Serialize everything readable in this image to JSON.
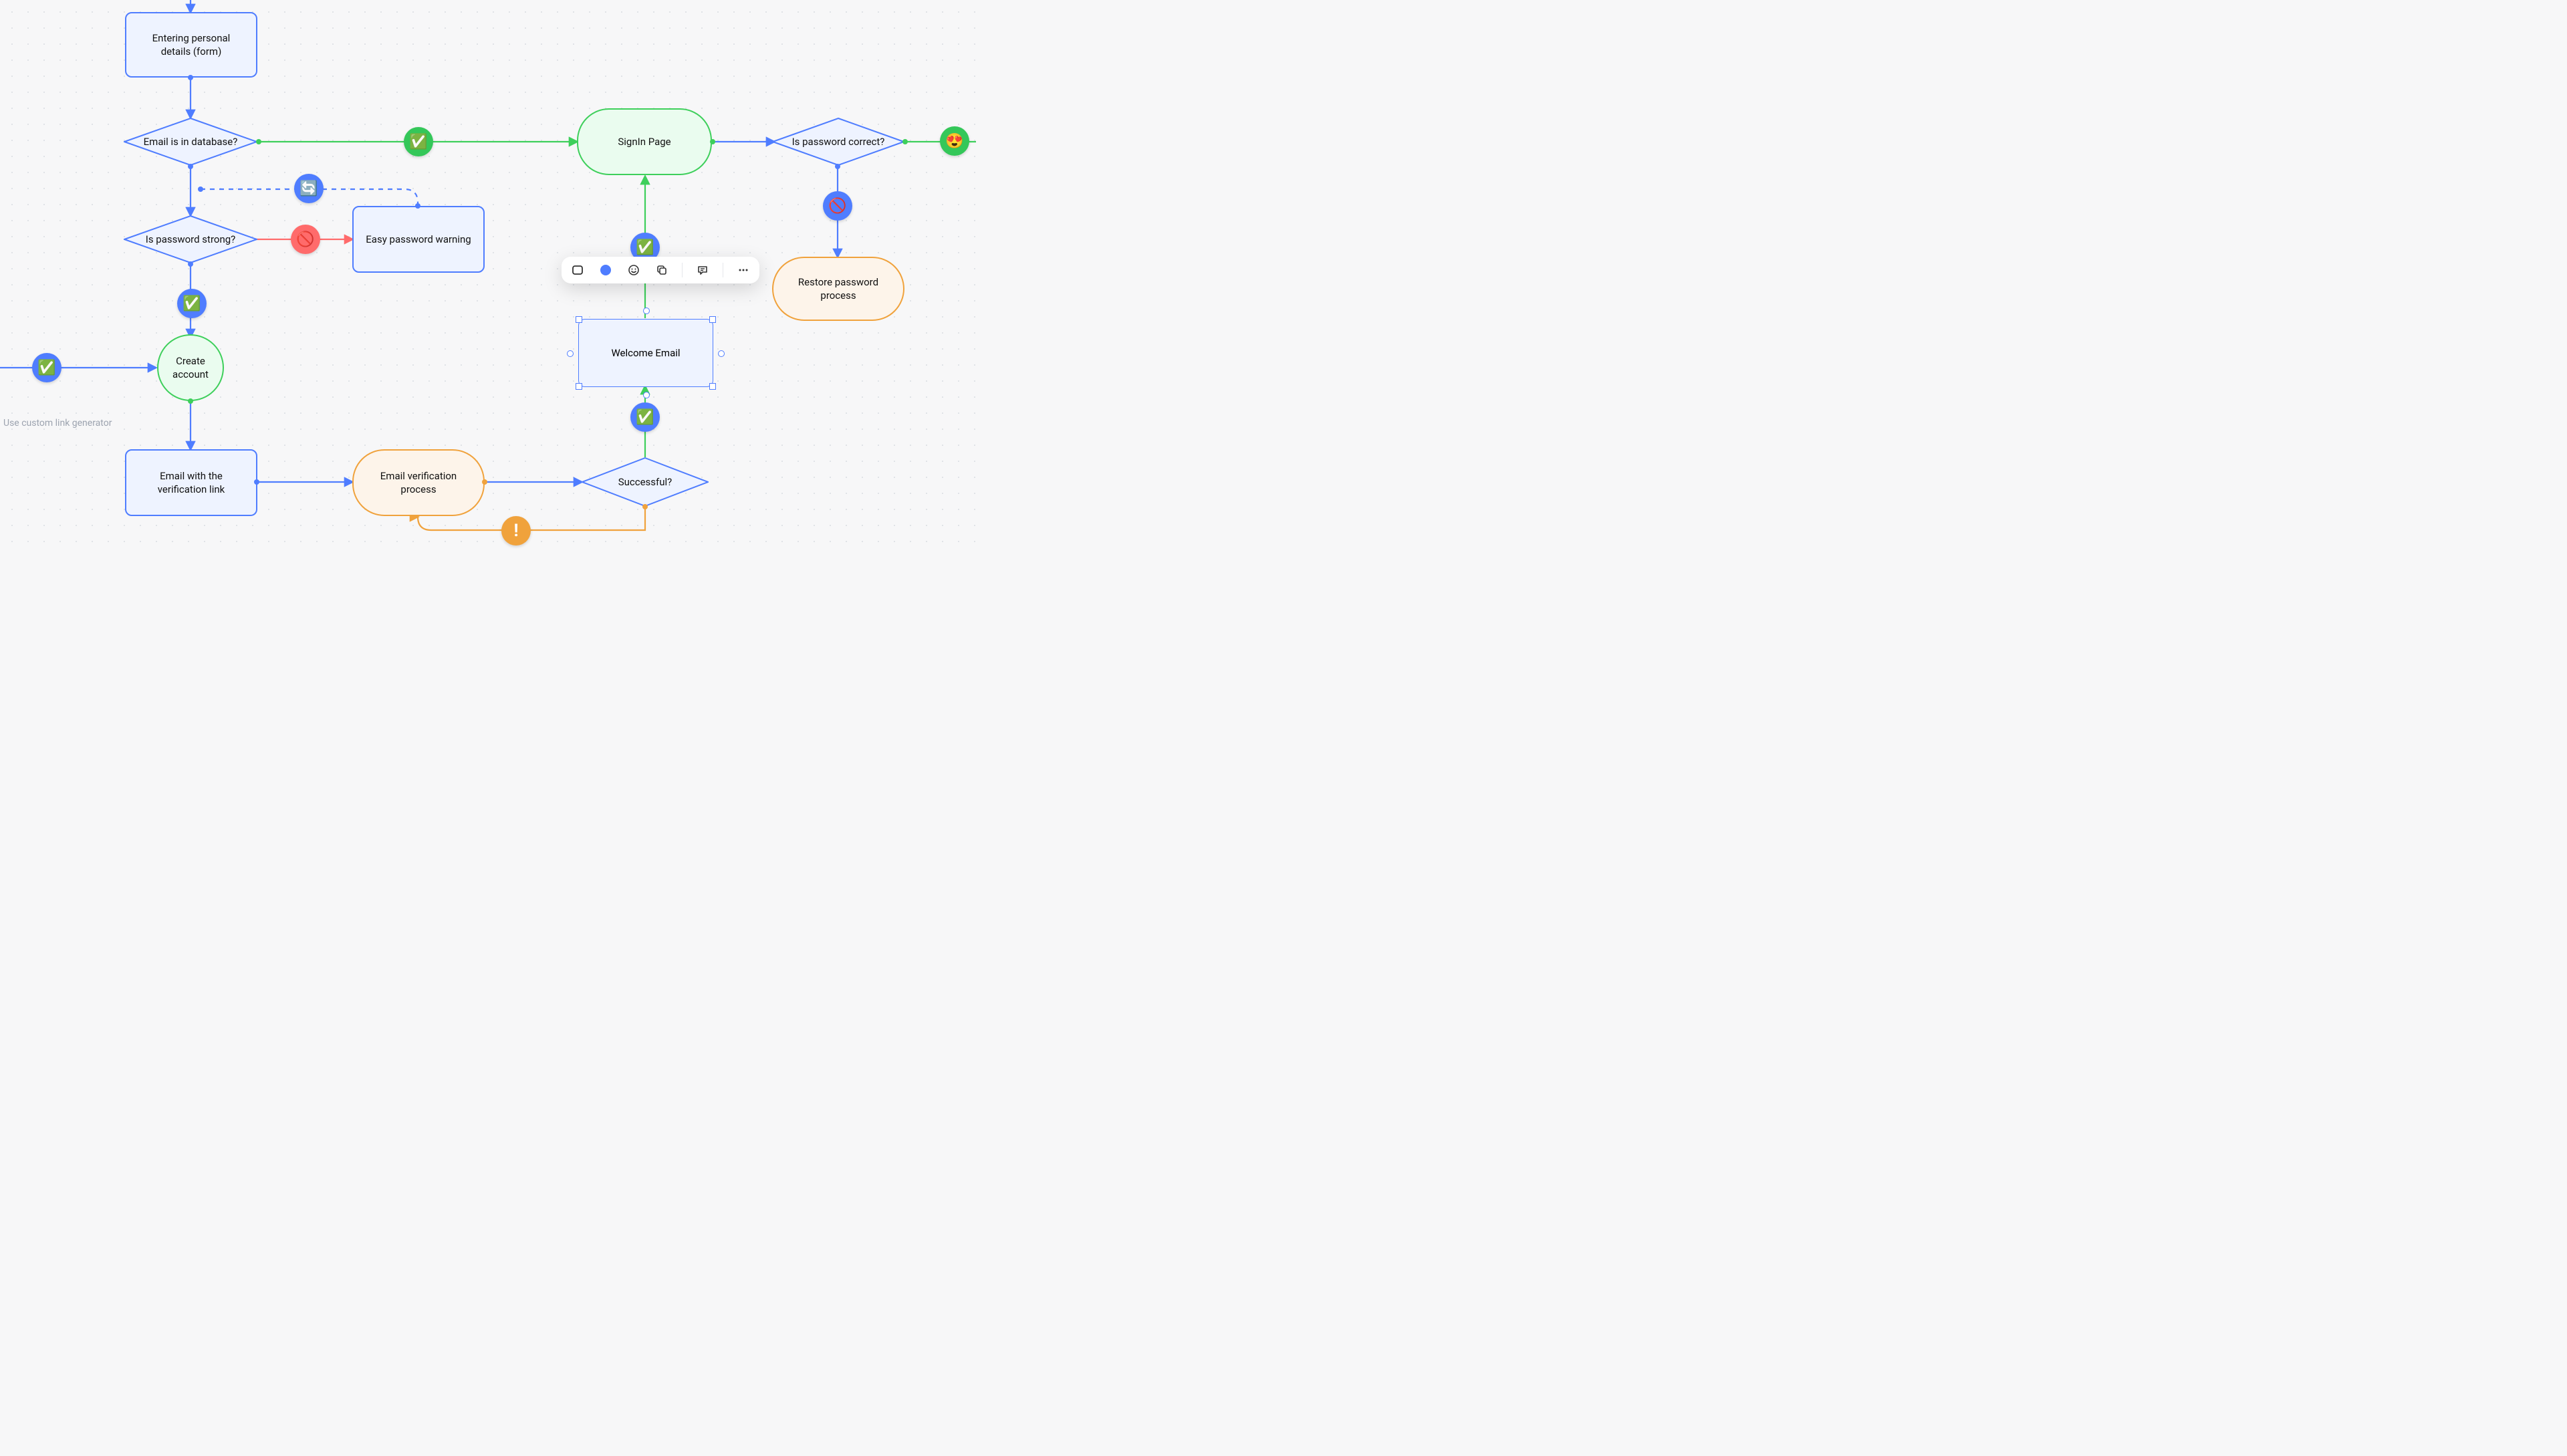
{
  "nodes": {
    "personal_details": "Entering personal\ndetails (form)",
    "email_db": "Email is in database?",
    "pw_strong": "Is password strong?",
    "pw_warning": "Easy password warning",
    "create_account": "Create\naccount",
    "email_link": "Email with the\nverification link",
    "email_verify": "Email verification\nprocess",
    "successful": "Successful?",
    "welcome": "Welcome Email",
    "signin": "SignIn Page",
    "pw_correct": "Is password correct?",
    "restore_pw": "Restore password\nprocess"
  },
  "note": "Use custom link generator",
  "badges": {
    "check": "✅",
    "check2": "✅",
    "check3": "✅",
    "check4": "✅",
    "check5": "✅",
    "refresh": "🔄",
    "no": "🚫",
    "no2": "🚫",
    "heart": "😍",
    "excl": "!"
  },
  "toolbar_icons": [
    "rectangle-icon",
    "color-fill-icon",
    "emoji-icon",
    "copy-icon",
    "comment-icon",
    "more-icon"
  ]
}
